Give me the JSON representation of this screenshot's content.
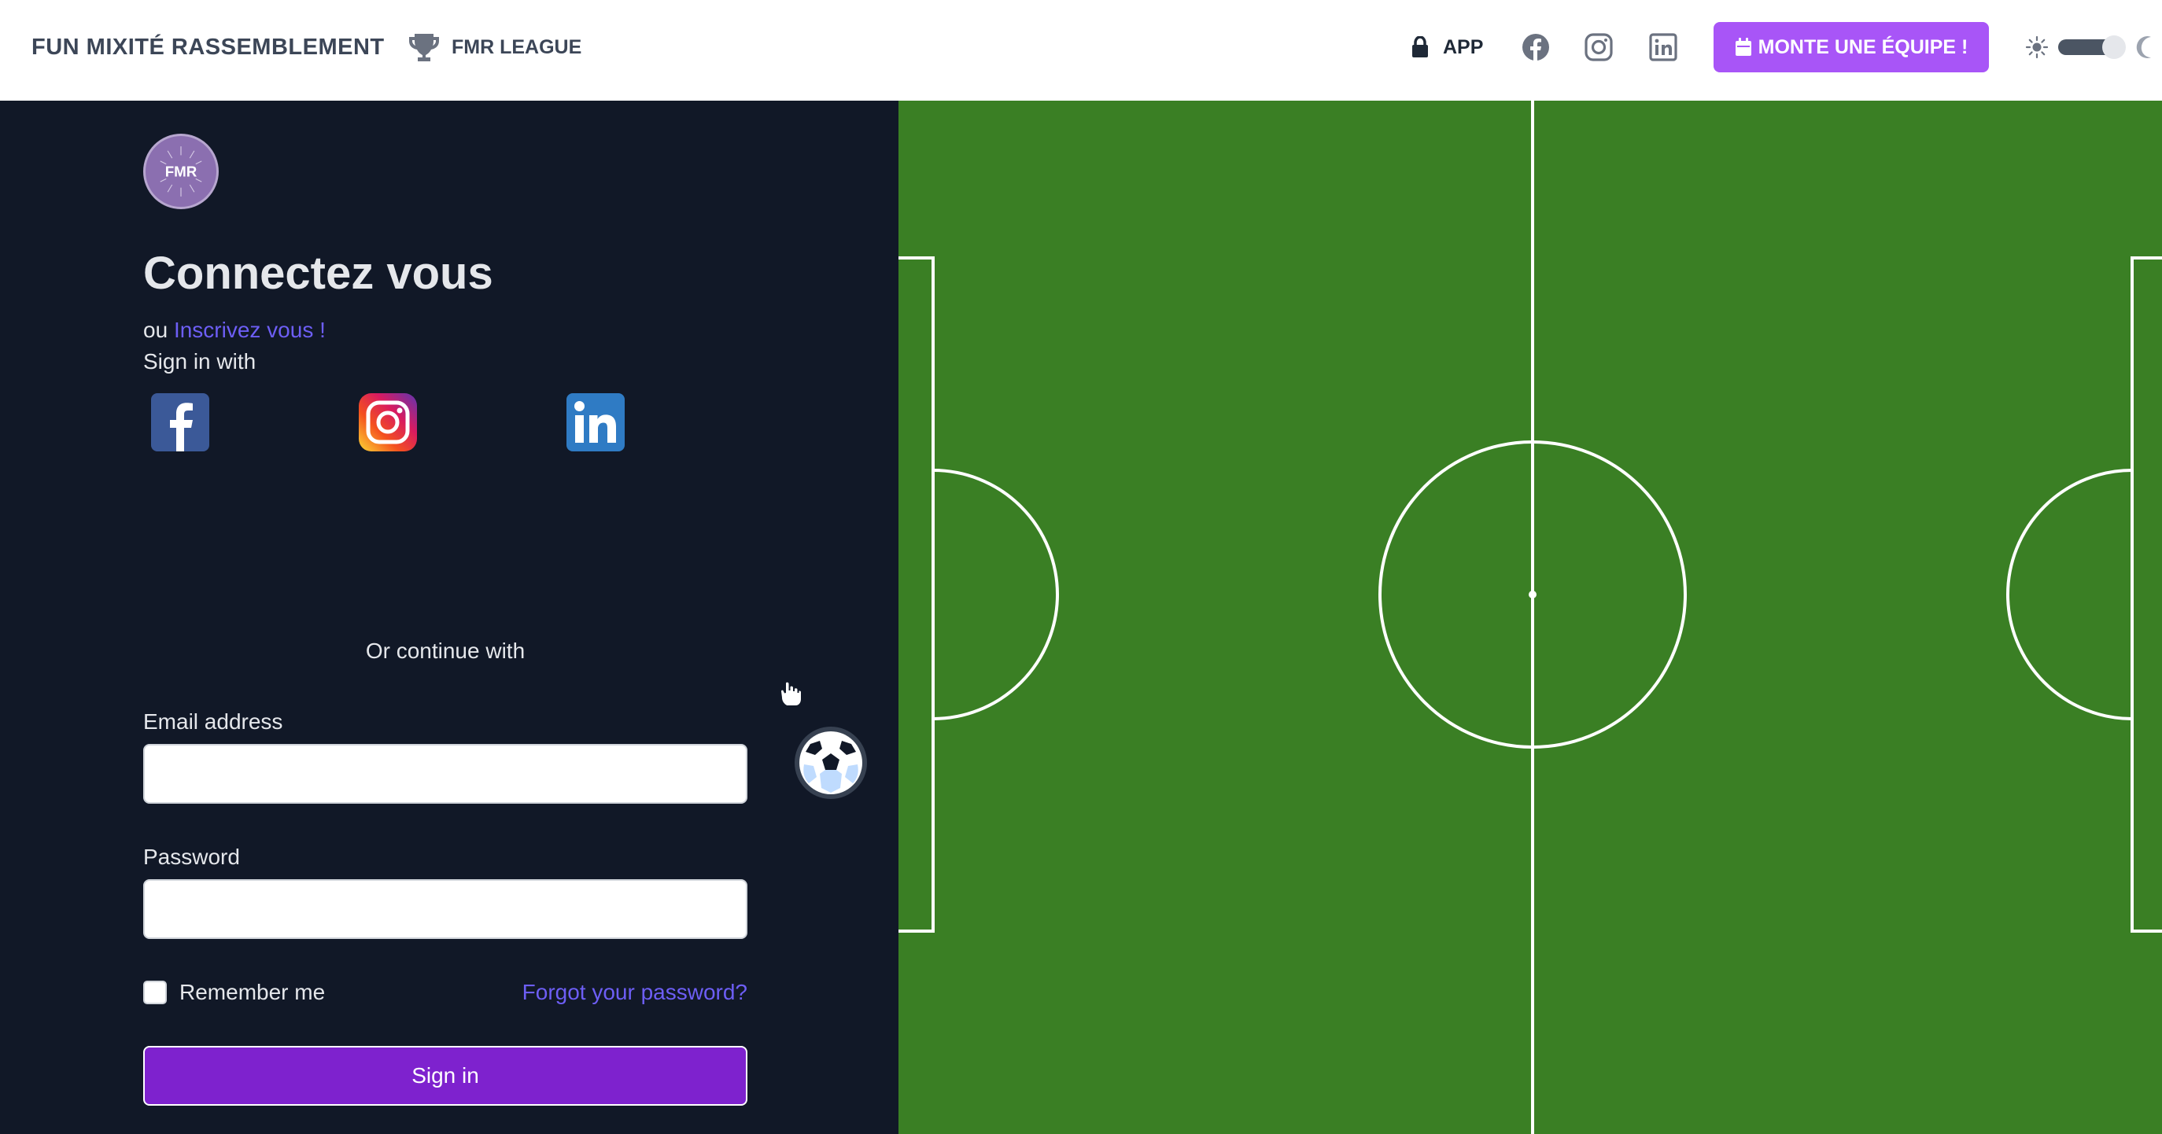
{
  "header": {
    "brand": "FUN MIXITÉ RASSEMBLEMENT",
    "league": "FMR LEAGUE",
    "app": "APP",
    "cta": "MONTE UNE ÉQUIPE !",
    "icons": [
      "trophy-icon",
      "lock-icon",
      "facebook-icon",
      "instagram-icon",
      "linkedin-icon",
      "calendar-icon",
      "sun-icon",
      "moon-icon"
    ]
  },
  "login": {
    "logo_text": "FMR",
    "title": "Connectez vous",
    "alt_prefix": "ou",
    "alt_link": "Inscrivez vous !",
    "signin_with": "Sign in with",
    "social": [
      "facebook",
      "instagram",
      "linkedin"
    ],
    "or_continue": "Or continue with",
    "email_label": "Email address",
    "email_value": "",
    "password_label": "Password",
    "password_value": "",
    "remember": "Remember me",
    "forgot": "Forgot your password?",
    "signin": "Sign in"
  },
  "colors": {
    "accent": "#a855f7",
    "primary_button": "#7e22ce",
    "link": "#6d5ef5",
    "panel": "#111827",
    "pitch": "#3a7f24"
  }
}
